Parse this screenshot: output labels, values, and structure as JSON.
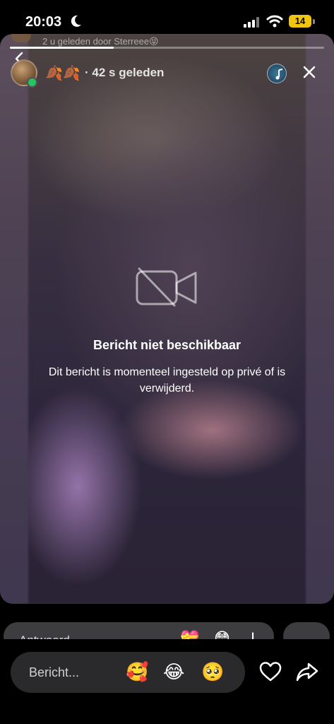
{
  "status_bar": {
    "time": "20:03",
    "battery": "14"
  },
  "story": {
    "previous_caption": "2 u geleden door Sterreee😝",
    "progress": 0.33,
    "username": "🍂🍂",
    "time_ago": "· 42 s geleden",
    "unavailable_title": "Bericht niet beschikbaar",
    "unavailable_description": "Dit bericht is momenteel ingesteld op privé of is verwijderd."
  },
  "reply_row": {
    "placeholder": "Antwoord",
    "emojis": [
      "💝",
      "😳",
      "I"
    ]
  },
  "composer": {
    "placeholder": "Bericht...",
    "emojis": [
      "🥰",
      "😂",
      "🥺"
    ]
  },
  "colors": {
    "online": "#22c55e",
    "battery": "#f1c40f"
  }
}
